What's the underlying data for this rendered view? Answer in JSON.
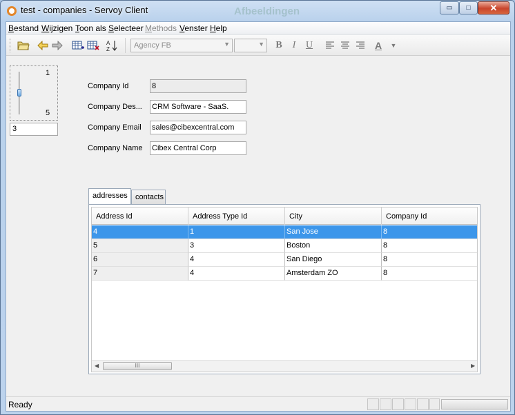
{
  "window": {
    "title": "test - companies - Servoy Client",
    "ghost_title": "Afbeeldingen",
    "controls": {
      "minimize": "▭",
      "maximize": "□",
      "close": "✕"
    }
  },
  "menubar": [
    {
      "label": "Bestand",
      "disabled": false
    },
    {
      "label": "Wijzigen",
      "disabled": false
    },
    {
      "label": "Toon als",
      "disabled": false
    },
    {
      "label": "Selecteer",
      "disabled": false
    },
    {
      "label": "Methods",
      "disabled": true
    },
    {
      "label": "Venster",
      "disabled": false
    },
    {
      "label": "Help",
      "disabled": false
    }
  ],
  "toolbar": {
    "icons": [
      "open-folder-icon",
      "back-arrow-icon",
      "forward-arrow-icon",
      "new-record-icon",
      "delete-record-icon",
      "sort-icon"
    ],
    "font_combo": "Agency FB",
    "size_combo": "",
    "format_buttons": {
      "bold": "B",
      "italic": "I",
      "underline": "U"
    },
    "align_icons": [
      "align-left-icon",
      "align-center-icon",
      "align-right-icon"
    ],
    "font_color_label": "A"
  },
  "slider": {
    "max": "1",
    "min": "5",
    "value": "3",
    "level_fraction": 0.5
  },
  "form": {
    "company_id_label": "Company Id",
    "company_id": "8",
    "company_desc_label": "Company Des...",
    "company_desc": "CRM Software - SaaS.",
    "company_email_label": "Company Email",
    "company_email": "sales@cibexcentral.com",
    "company_name_label": "Company Name",
    "company_name": "Cibex Central Corp"
  },
  "tabs": [
    {
      "label": "addresses",
      "active": true
    },
    {
      "label": "contacts",
      "active": false
    }
  ],
  "table": {
    "columns": [
      "Address Id",
      "Address Type Id",
      "City",
      "Company Id"
    ],
    "rows": [
      [
        "4",
        "1",
        "San Jose",
        "8"
      ],
      [
        "5",
        "3",
        "Boston",
        "8"
      ],
      [
        "6",
        "4",
        "San Diego",
        "8"
      ],
      [
        "7",
        "4",
        "Amsterdam ZO",
        "8"
      ]
    ],
    "selected_row": 0,
    "scroll_thumb": "III"
  },
  "status": {
    "text": "Ready"
  },
  "colors": {
    "selection": "#3c96ea",
    "accent_icon": "#e3862a"
  }
}
